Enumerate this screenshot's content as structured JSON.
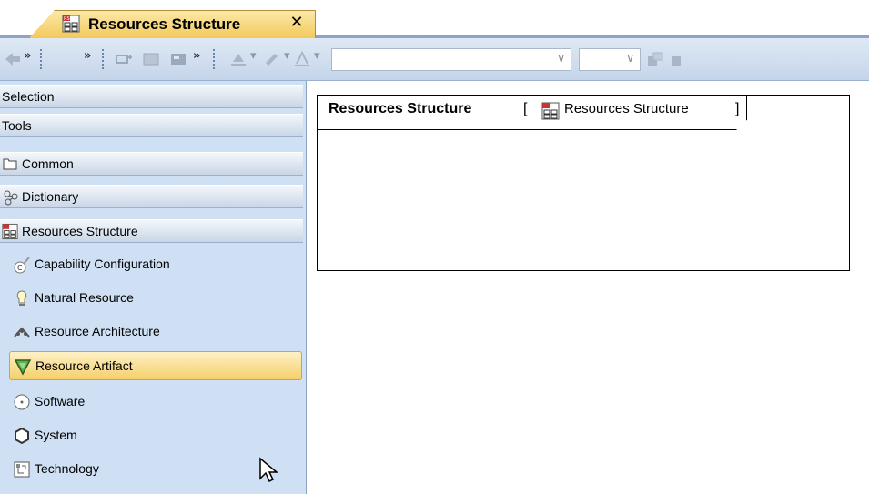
{
  "tab": {
    "title": "Resources Structure",
    "close_label": "✕"
  },
  "palette": {
    "sections": [
      {
        "label": "Selection"
      },
      {
        "label": "Tools"
      },
      {
        "label": "Common"
      },
      {
        "label": "Dictionary"
      },
      {
        "label": "Resources Structure"
      }
    ],
    "items": [
      {
        "label": "Capability Configuration",
        "icon": "capability-configuration-icon"
      },
      {
        "label": "Natural Resource",
        "icon": "natural-resource-icon"
      },
      {
        "label": "Resource Architecture",
        "icon": "resource-architecture-icon"
      },
      {
        "label": "Resource Artifact",
        "icon": "resource-artifact-icon",
        "selected": true
      },
      {
        "label": "Software",
        "icon": "software-icon"
      },
      {
        "label": "System",
        "icon": "system-icon"
      },
      {
        "label": "Technology",
        "icon": "technology-icon"
      }
    ]
  },
  "diagram": {
    "name": "Resources Structure",
    "type_label": "Resources Structure"
  },
  "colors": {
    "accent_tab": "#f3c95b",
    "palette_bg": "#cfe0f4",
    "selected_item": "#f5cf6a"
  }
}
